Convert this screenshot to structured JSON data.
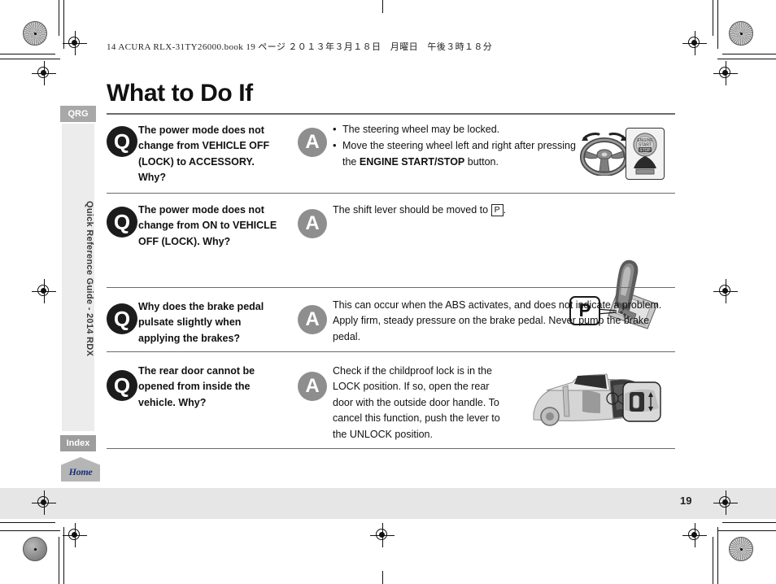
{
  "runhead": "14 ACURA RLX-31TY26000.book   19 ページ   ２０１３年３月１８日　月曜日　午後３時１８分",
  "page": {
    "title": "What to Do If",
    "folio": "19"
  },
  "sidebar": {
    "tabs": [
      {
        "label": "QRG"
      },
      {
        "label": "Index"
      }
    ],
    "rail_label": "Quick Reference Guide - 2014 RDX",
    "home_label": "Home"
  },
  "badges": {
    "q": "Q",
    "a": "A"
  },
  "qa_rows": [
    {
      "question": "The power mode does not change from VEHICLE OFF (LOCK) to ACCESSORY. Why?",
      "answer_bullets": [
        "The steering wheel may be locked.",
        "Move the steering wheel left and right after pressing the ENGINE START/STOP button."
      ],
      "answer_bold_term": "ENGINE START/STOP",
      "figure": "steering-wheel-and-engine-start-stop-button",
      "button_label_lines": [
        "ENGINE",
        "START",
        "STOP"
      ]
    },
    {
      "question": "The power mode does not change from ON to VEHICLE OFF (LOCK). Why?",
      "answer": "The shift lever should be moved to ",
      "answer_key": "P",
      "answer_tail": ".",
      "figure": "shift-lever-park-position",
      "callout_label": "P"
    },
    {
      "question": "Why does the brake pedal pulsate slightly when applying the brakes?",
      "answer": "This can occur when the ABS activates, and does not indicate a problem. Apply firm, steady pressure on the brake pedal. Never pump the brake pedal.",
      "figure": null
    },
    {
      "question": "The rear door cannot be opened from inside the vehicle. Why?",
      "answer": "Check if the childproof lock is in the LOCK position. If so, open the rear door with the outside door handle. To cancel this function, push the lever to the UNLOCK position.",
      "figure": "rear-door-childproof-lock"
    }
  ],
  "colors": {
    "q_badge": "#1c1c1c",
    "a_badge": "#8e8e8e",
    "tab": "#a8a8a8",
    "rail": "#ececec",
    "rule": "#6b6b6b",
    "footer_band": "#e6e6e6",
    "home_text": "#1a2f7a"
  }
}
